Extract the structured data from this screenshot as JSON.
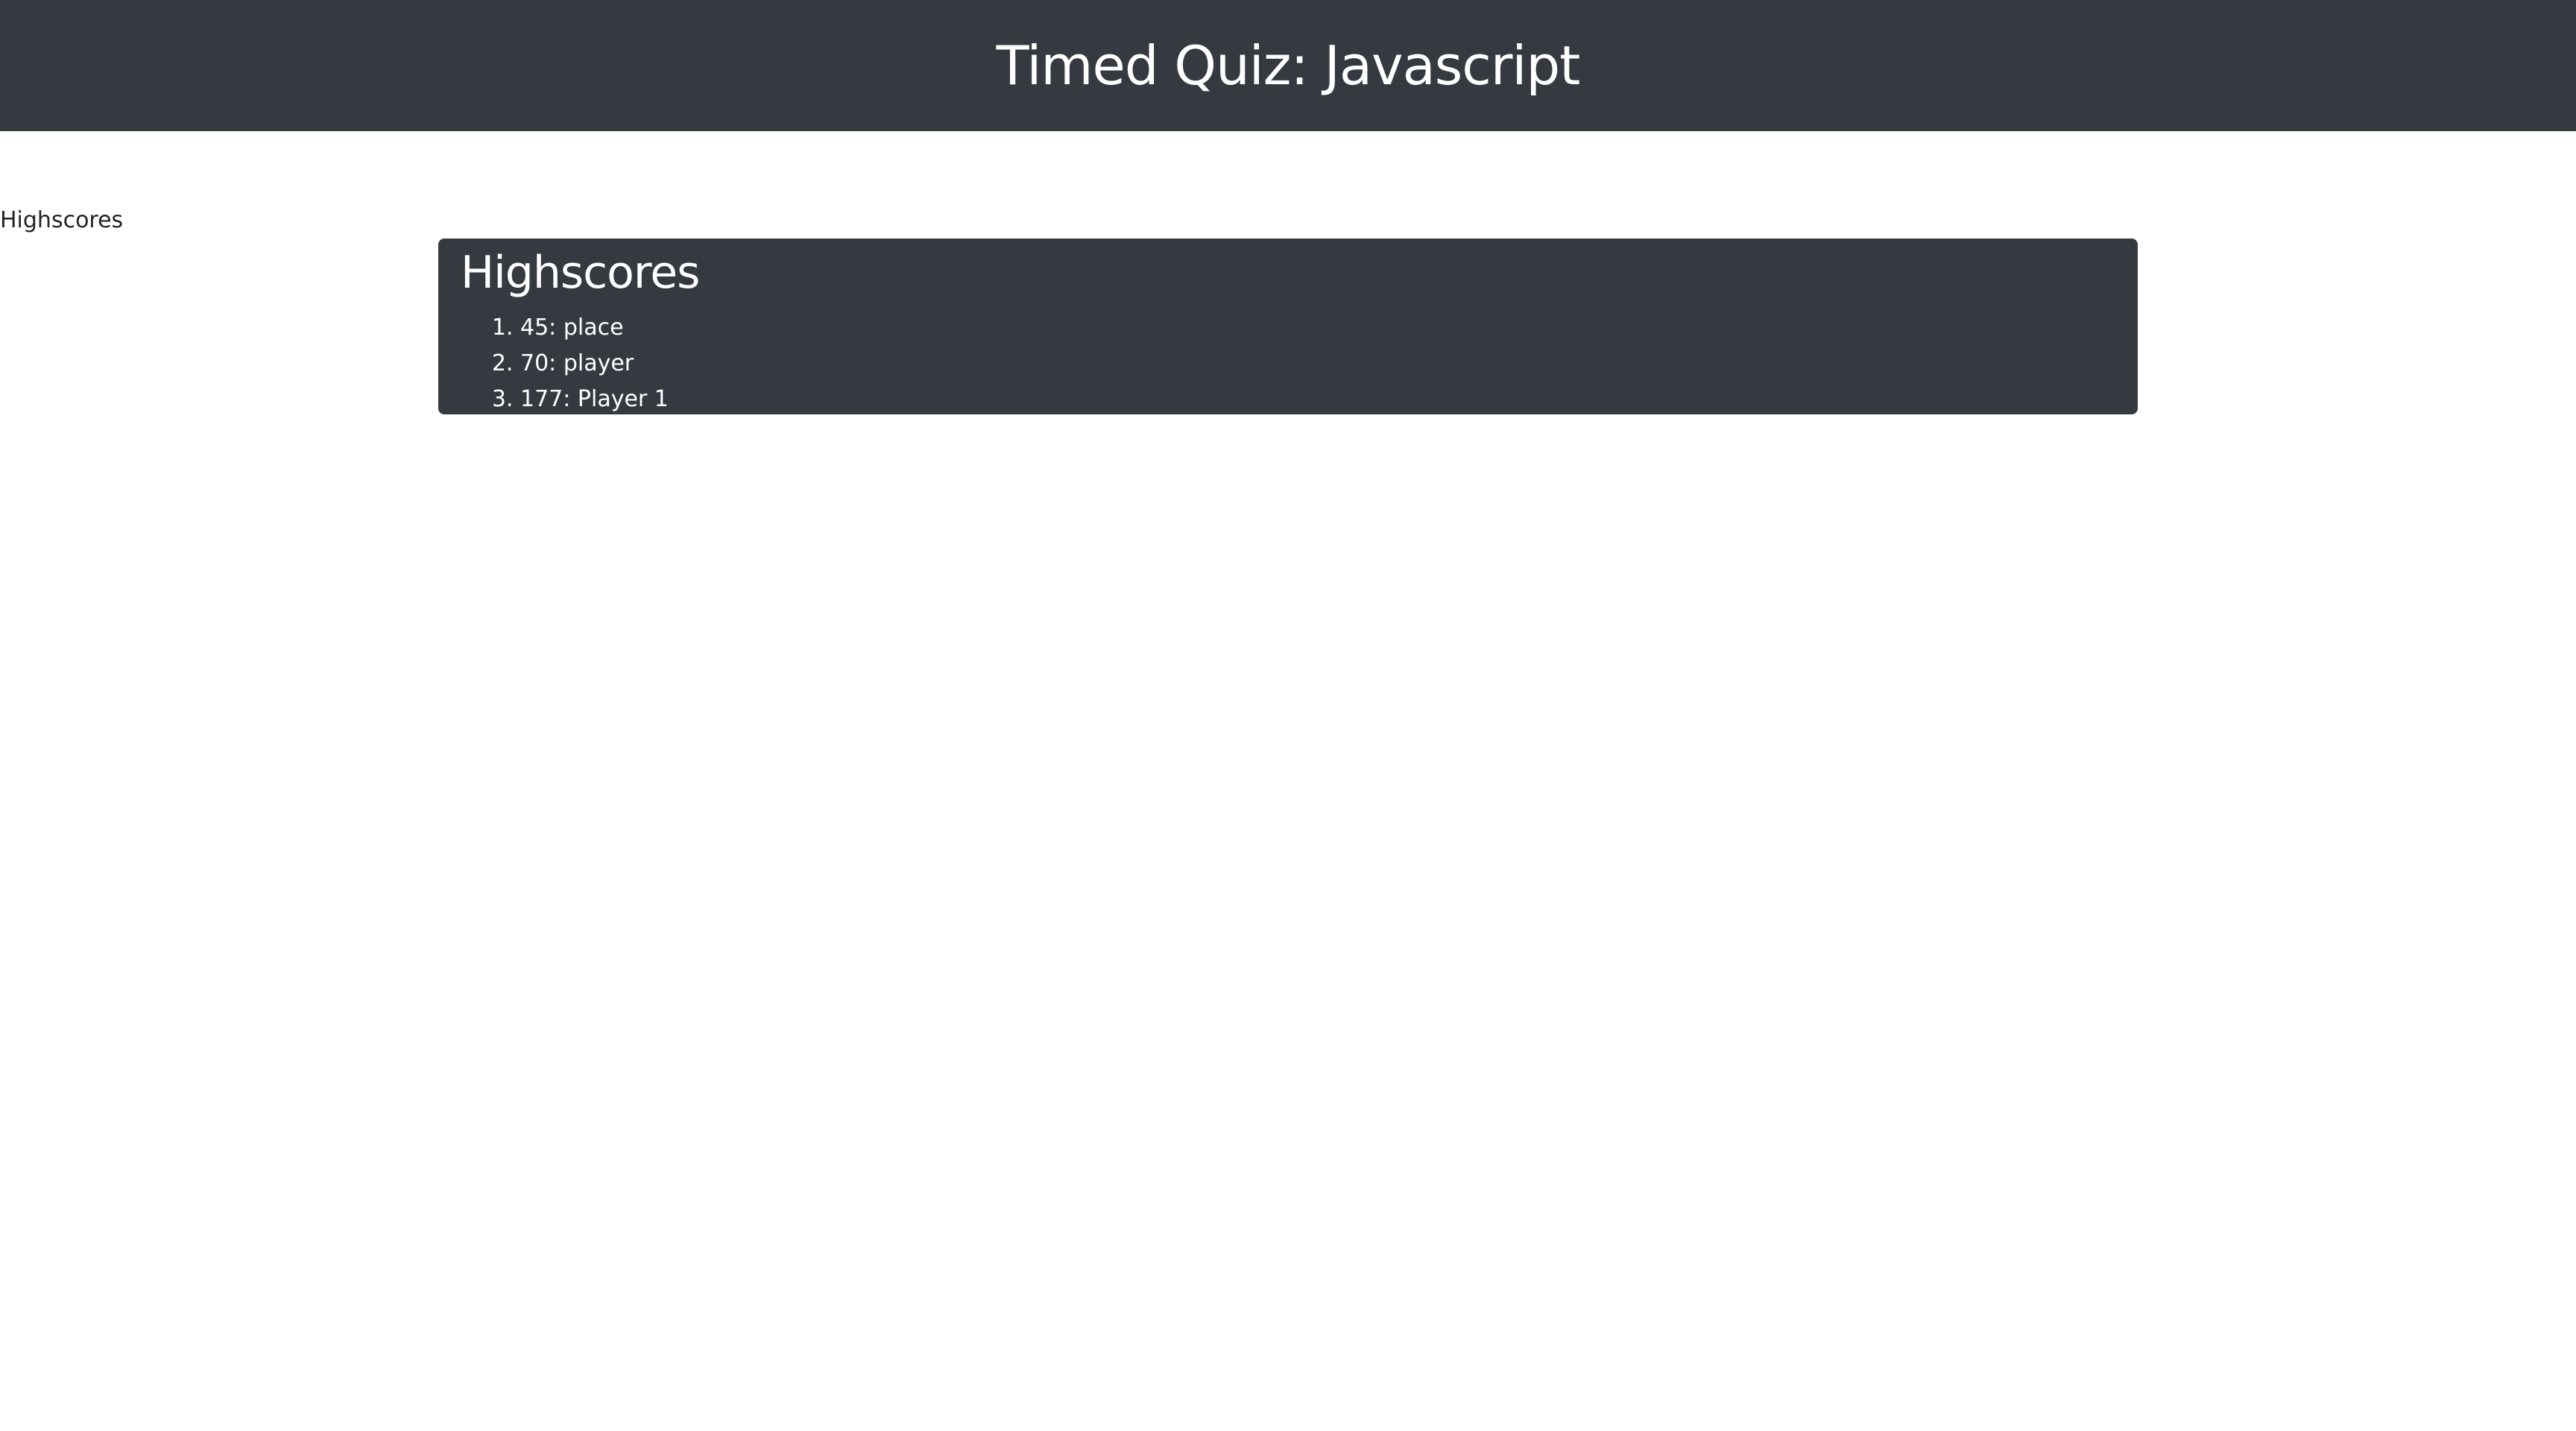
{
  "header": {
    "title": "Timed Quiz: Javascript",
    "background_color": "#343a40"
  },
  "nav": {
    "highscores_link": "Highscores"
  },
  "highscores": {
    "title": "Highscores",
    "entries": [
      {
        "text": "45: place"
      },
      {
        "text": "70: player"
      },
      {
        "text": "177: Player 1"
      }
    ]
  }
}
